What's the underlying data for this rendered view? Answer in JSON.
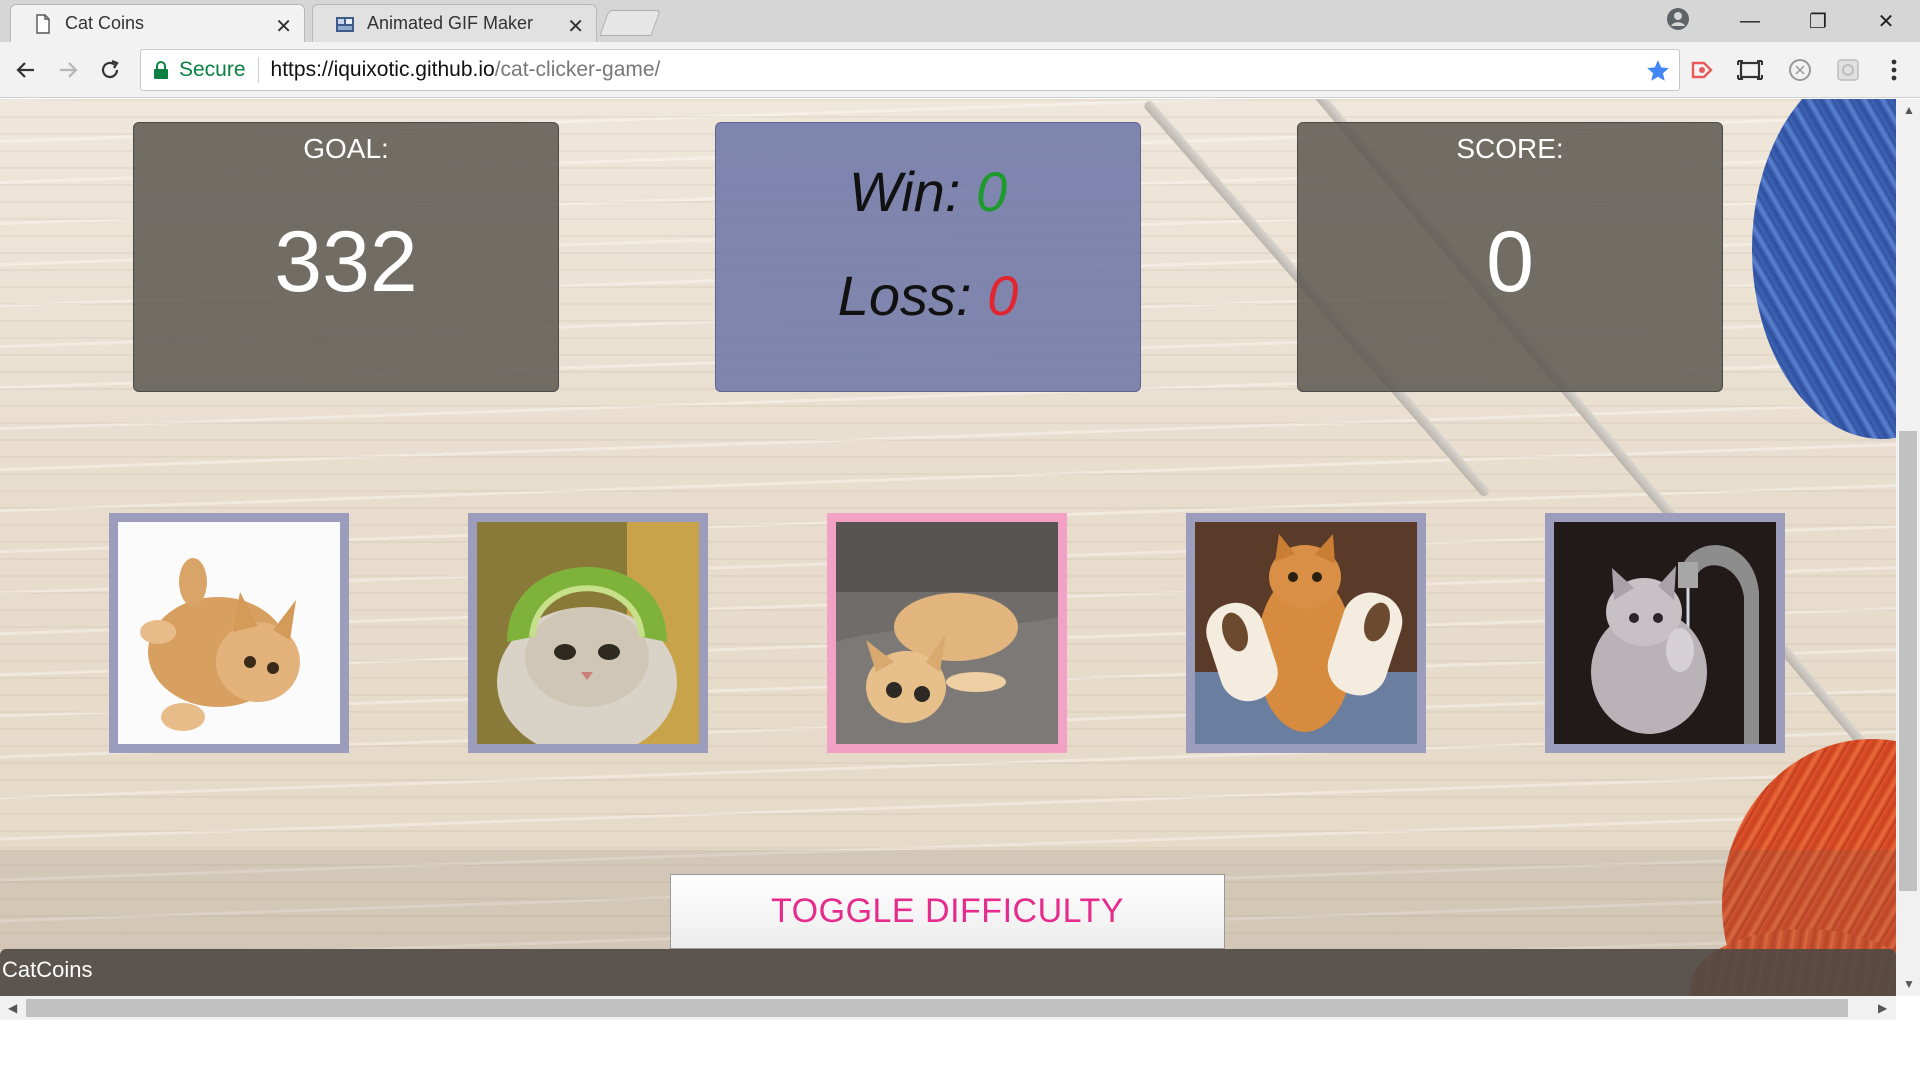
{
  "browser": {
    "tabs": [
      {
        "title": "Cat Coins",
        "active": true
      },
      {
        "title": "Animated GIF Maker",
        "active": false
      }
    ],
    "close_glyph": "✕",
    "window_controls": {
      "minimize": "—",
      "restore": "❐",
      "close": "✕"
    },
    "address": {
      "secure_label": "Secure",
      "url_host": "https://iquixotic.github.io",
      "url_path": "/cat-clicker-game/"
    },
    "icons": [
      "page-icon",
      "gif-maker-icon",
      "back-icon",
      "forward-icon",
      "reload-icon",
      "lock-icon",
      "star-icon",
      "cast-icon",
      "screenshot-icon",
      "extension-icon",
      "extension-icon-2",
      "menu-icon",
      "profile-icon"
    ]
  },
  "game": {
    "goal": {
      "label": "GOAL:",
      "value": "332"
    },
    "score": {
      "label": "SCORE:",
      "value": "0"
    },
    "record": {
      "win_label": "Win:",
      "win_value": "0",
      "loss_label": "Loss:",
      "loss_value": "0"
    },
    "cats": [
      {
        "name": "kitten-rolling"
      },
      {
        "name": "cat-lime-helmet"
      },
      {
        "name": "kitten-on-sofa"
      },
      {
        "name": "cat-toilet-paper"
      },
      {
        "name": "kitten-faucet"
      }
    ],
    "toggle_label": "TOGGLE DIFFICULTY",
    "footer_label": "CatCoins"
  },
  "colors": {
    "win_green": "#1d9a2d",
    "loss_red": "#e2262f",
    "toggle_pink": "#e52b8c",
    "tile_border": "#9c9cbc",
    "tile_border_highlight": "#f3a1c4"
  }
}
